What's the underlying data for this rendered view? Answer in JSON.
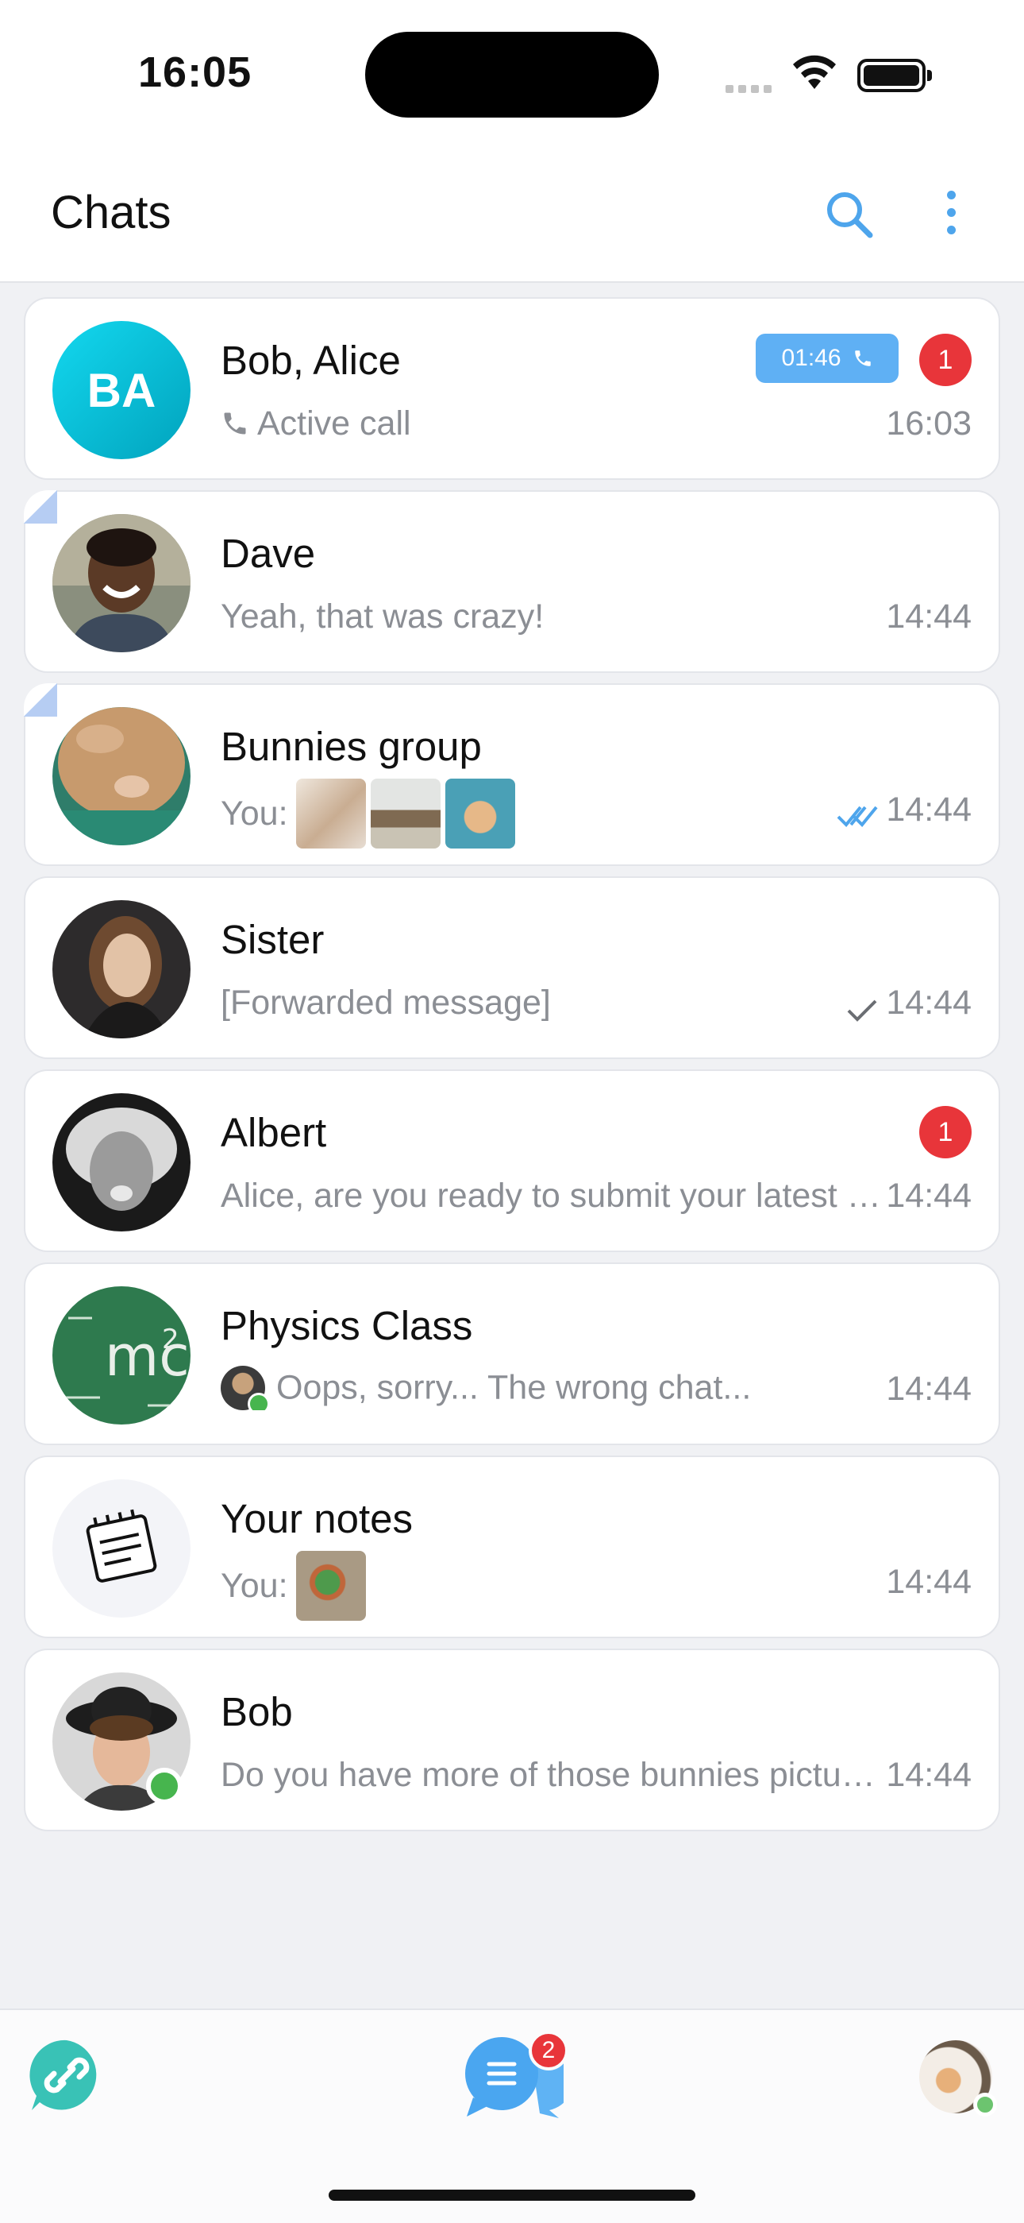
{
  "status_bar": {
    "time": "16:05"
  },
  "header": {
    "title": "Chats"
  },
  "chats": [
    {
      "initials": "BA",
      "name": "Bob, Alice",
      "preview": "Active call",
      "time": "16:03",
      "call_duration": "01:46",
      "unread": "1"
    },
    {
      "name": "Dave",
      "preview": "Yeah, that was crazy!",
      "time": "14:44"
    },
    {
      "name": "Bunnies group",
      "preview_prefix": "You:",
      "time": "14:44",
      "status": "read"
    },
    {
      "name": "Sister",
      "preview": "[Forwarded message]",
      "time": "14:44",
      "status": "sent"
    },
    {
      "name": "Albert",
      "preview": "Alice, are you ready to submit your latest …",
      "time": "14:44",
      "unread": "1"
    },
    {
      "name": "Physics Class",
      "preview": "Oops, sorry... The wrong chat...",
      "time": "14:44"
    },
    {
      "name": "Your notes",
      "preview_prefix": "You:",
      "time": "14:44"
    },
    {
      "name": "Bob",
      "preview": "Do you have more of those bunnies pictu…",
      "time": "14:44",
      "online": true
    }
  ],
  "tabbar": {
    "chats_badge": "2"
  },
  "colors": {
    "accent": "#4ea5ec",
    "badge": "#e8353a",
    "online": "#47b54e",
    "call_pill": "#5fb0f4"
  }
}
